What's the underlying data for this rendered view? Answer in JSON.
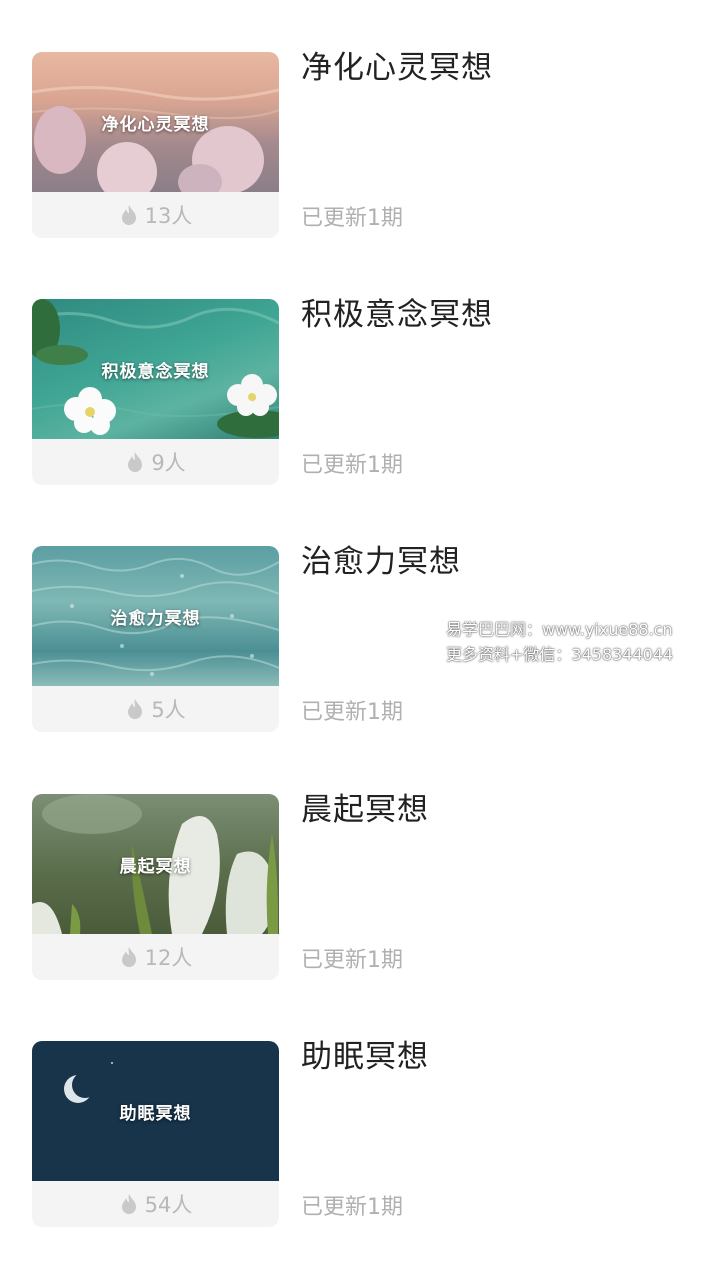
{
  "items": [
    {
      "title": "净化心灵冥想",
      "thumb_label": "净化心灵冥想",
      "count": "13人",
      "status": "已更新1期"
    },
    {
      "title": "积极意念冥想",
      "thumb_label": "积极意念冥想",
      "count": "9人",
      "status": "已更新1期"
    },
    {
      "title": "治愈力冥想",
      "thumb_label": "治愈力冥想",
      "count": "5人",
      "status": "已更新1期"
    },
    {
      "title": "晨起冥想",
      "thumb_label": "晨起冥想",
      "count": "12人",
      "status": "已更新1期"
    },
    {
      "title": "助眠冥想",
      "thumb_label": "助眠冥想",
      "count": "54人",
      "status": "已更新1期"
    }
  ],
  "watermark": {
    "line1": "易学巴巴网：www.yixue88.cn",
    "line2": "更多资料+微信：3458344044"
  },
  "icons": {
    "count_icon": "flame-icon"
  },
  "colors": {
    "count_text": "#b8b8b8",
    "status_text": "#b0b0b0",
    "title_text": "#222222"
  }
}
